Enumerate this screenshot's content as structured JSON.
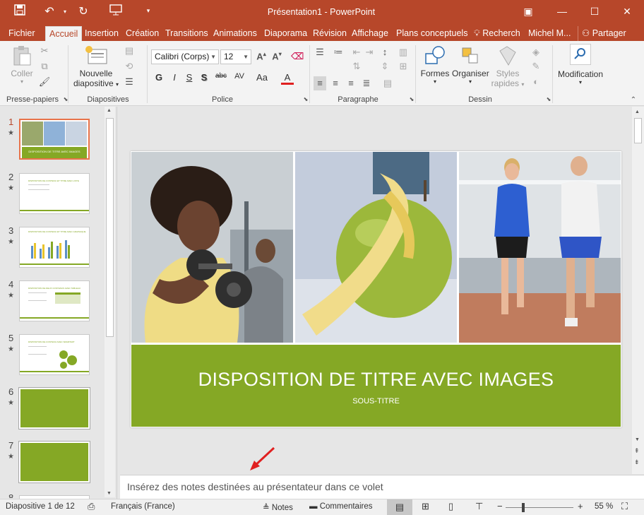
{
  "window": {
    "title": "Présentation1 - PowerPoint"
  },
  "qat": {
    "save_icon": "save-icon",
    "undo_icon": "undo-icon",
    "redo_icon": "redo-icon",
    "present_icon": "present-icon"
  },
  "tabs": [
    "Fichier",
    "Accueil",
    "Insertion",
    "Création",
    "Transitions",
    "Animations",
    "Diaporama",
    "Révision",
    "Affichage",
    "Plans conceptuels"
  ],
  "tell_me": "Recherch",
  "user": "Michel M...",
  "share": "Partager",
  "ribbon": {
    "clipboard": {
      "paste": "Coller",
      "label": "Presse-papiers"
    },
    "slides": {
      "new_slide_line1": "Nouvelle",
      "new_slide_line2": "diapositive",
      "label": "Diapositives"
    },
    "font": {
      "name": "Calibri (Corps)",
      "size": "12",
      "label": "Police",
      "bold": "G",
      "italic": "I",
      "underline": "S",
      "shadow": "S",
      "strike": "abc",
      "spacing": "AV",
      "case": "Aa",
      "color": "A"
    },
    "paragraph": {
      "label": "Paragraphe"
    },
    "drawing": {
      "shapes": "Formes",
      "arrange": "Organiser",
      "styles_line1": "Styles",
      "styles_line2": "rapides",
      "label": "Dessin"
    },
    "editing": {
      "find": "Modification"
    }
  },
  "thumbnails": [
    {
      "num": "1",
      "title": "DISPOSITION DE TITRE AVEC IMAGES"
    },
    {
      "num": "2",
      "title": "DISPOSITION DE CONTENU ET TITRE AVEC LISTE"
    },
    {
      "num": "3",
      "title": "DISPOSITION DE CONTENU ET TITRE AVEC GRAPHIQUE"
    },
    {
      "num": "4",
      "title": "DISPOSITION DE DEUX CONTENUS AVEC TABLEAU"
    },
    {
      "num": "5",
      "title": "DISPOSITION DE CONTENU AVEC SMARTART"
    },
    {
      "num": "6",
      "title": ""
    },
    {
      "num": "7",
      "title": ""
    },
    {
      "num": "8",
      "title": ""
    }
  ],
  "slide": {
    "title": "DISPOSITION DE TITRE AVEC IMAGES",
    "subtitle": "SOUS-TITRE"
  },
  "notes": {
    "placeholder": "Insérez des notes destinées au présentateur dans ce volet"
  },
  "status": {
    "slide_info": "Diapositive 1 de 12",
    "language": "Français (France)",
    "notes": "Notes",
    "comments": "Commentaires",
    "zoom": "55 %"
  },
  "colors": {
    "accent": "#b7472a",
    "slide_band": "#85a825",
    "annotation_arrow": "#e02020"
  }
}
